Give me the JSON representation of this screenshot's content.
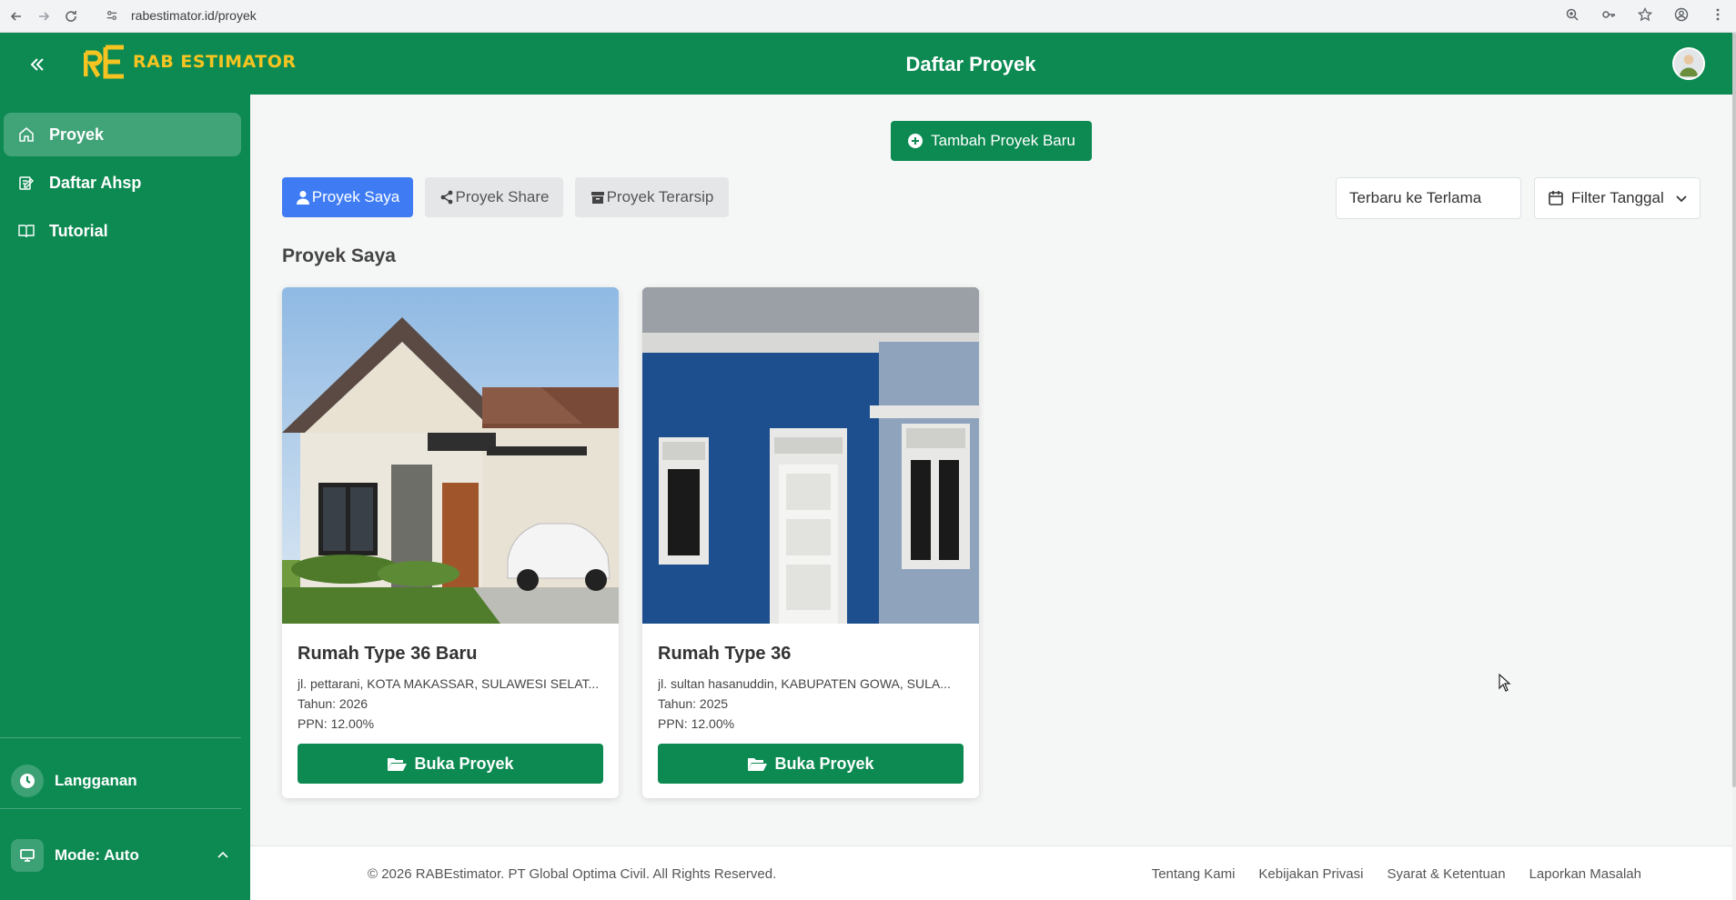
{
  "browser": {
    "url": "rabestimator.id/proyek"
  },
  "header": {
    "logo_text": "RAB ESTIMATOR",
    "title": "Daftar Proyek"
  },
  "sidebar": {
    "items": [
      {
        "label": "Proyek",
        "icon": "home-icon",
        "active": true
      },
      {
        "label": "Daftar Ahsp",
        "icon": "edit-note-icon",
        "active": false
      },
      {
        "label": "Tutorial",
        "icon": "book-icon",
        "active": false
      }
    ],
    "subscription_label": "Langganan",
    "mode_label": "Mode: Auto"
  },
  "main": {
    "add_button_label": "Tambah Proyek Baru",
    "tabs": [
      {
        "label": "Proyek Saya",
        "icon": "user-icon",
        "active": true
      },
      {
        "label": "Proyek Share",
        "icon": "share-icon",
        "active": false
      },
      {
        "label": "Proyek Terarsip",
        "icon": "archive-icon",
        "active": false
      }
    ],
    "sort_value": "Terbaru ke Terlama",
    "filter_label": "Filter Tanggal",
    "section_title": "Proyek Saya",
    "projects": [
      {
        "title": "Rumah Type 36 Baru",
        "address": "jl. pettarani, KOTA MAKASSAR, SULAWESI SELAT...",
        "year": "Tahun: 2026",
        "ppn": "PPN: 12.00%",
        "button_label": "Buka Proyek"
      },
      {
        "title": "Rumah Type 36",
        "address": "jl. sultan hasanuddin, KABUPATEN GOWA, SULA...",
        "year": "Tahun: 2025",
        "ppn": "PPN: 12.00%",
        "button_label": "Buka Proyek"
      }
    ]
  },
  "footer": {
    "copyright": "© 2026 RABEstimator. PT Global Optima Civil. All Rights Reserved.",
    "links": [
      "Tentang Kami",
      "Kebijakan Privasi",
      "Syarat & Ketentuan",
      "Laporkan Masalah"
    ]
  },
  "colors": {
    "brand_green": "#0c8a52",
    "logo_yellow": "#f6c421",
    "tab_active_blue": "#3f7cf4"
  }
}
